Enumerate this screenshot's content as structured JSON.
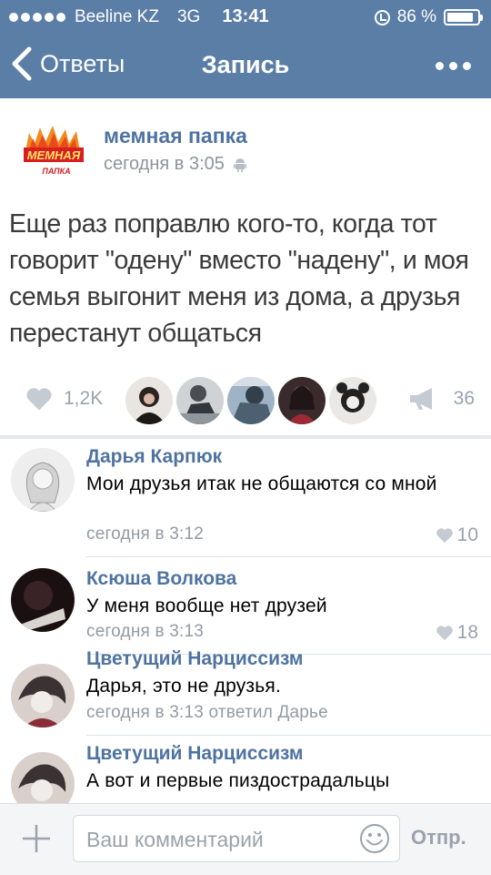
{
  "status_bar": {
    "carrier": "Beeline KZ",
    "network": "3G",
    "time": "13:41",
    "battery": "86 %",
    "battery_level": 0.86
  },
  "nav": {
    "back_label": "Ответы",
    "title": "Запись"
  },
  "post": {
    "logo_text_top": "МЕМНАЯ",
    "logo_text_bottom": "ПАПКА",
    "author": "мемная папка",
    "time": "сегодня в 3:05",
    "text": "Еще раз поправлю кого-то, когда тот говорит \"одену\" вместо \"надену\", и моя семья выгонит меня из дома, а друзья перестанут общаться",
    "likes": "1,2K",
    "shares": "36"
  },
  "comments": [
    {
      "name": "Дарья Карпюк",
      "text": "Мои друзья итак не общаются со мной",
      "time": "сегодня в 3:12",
      "likes": "10"
    },
    {
      "name": "Ксюша Волкова",
      "text": "У меня вообще нет друзей",
      "time": "сегодня в 3:13",
      "likes": "18"
    },
    {
      "name": "Цветущий Нарциссизм",
      "text": "Дарья, это не друзья.",
      "time": "сегодня в 3:13 ответил Дарье",
      "likes": ""
    },
    {
      "name": "Цветущий Нарциссизм",
      "text": "А вот и первые пиздострадальцы",
      "time": "",
      "likes": ""
    }
  ],
  "composer": {
    "placeholder": "Ваш комментарий",
    "send_label": "Отпр."
  },
  "colors": {
    "header": "#5b7ea6",
    "link": "#4e73a1",
    "muted": "#99a2ad"
  }
}
